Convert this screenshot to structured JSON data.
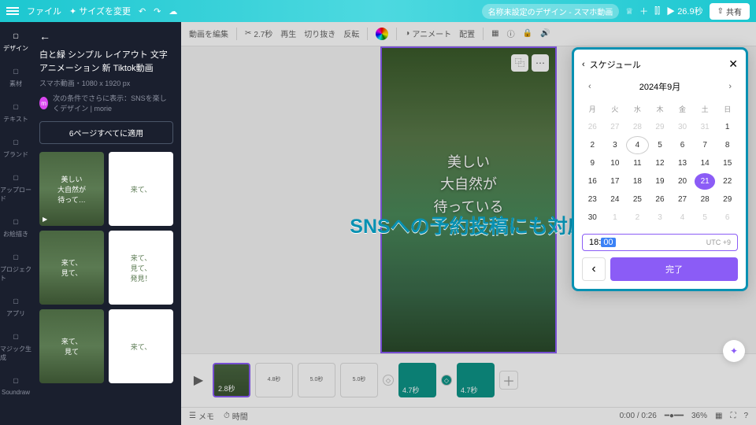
{
  "topbar": {
    "file_label": "ファイル",
    "resize_label": "サイズを変更",
    "doc_title": "名称未設定のデザイン - スマホ動画",
    "duration": "26.9秒",
    "share": "共有"
  },
  "rail": [
    {
      "label": "デザイン",
      "icon": "layout"
    },
    {
      "label": "素材",
      "icon": "shapes"
    },
    {
      "label": "テキスト",
      "icon": "text"
    },
    {
      "label": "ブランド",
      "icon": "brand"
    },
    {
      "label": "アップロード",
      "icon": "upload"
    },
    {
      "label": "お絵描き",
      "icon": "draw"
    },
    {
      "label": "プロジェクト",
      "icon": "folder"
    },
    {
      "label": "アプリ",
      "icon": "apps"
    },
    {
      "label": "マジック生成",
      "icon": "magic"
    },
    {
      "label": "Soundraw",
      "icon": "music"
    }
  ],
  "sidepanel": {
    "title": "白と緑  シンプル  レイアウト  文字アニメーション  新  Tiktok動画",
    "subtitle": "スマホ動画・1080 x 1920 px",
    "info": "次の条件でさらに表示：SNSを楽しくデザイン | morie",
    "apply": "6ページすべてに適用",
    "thumbs": [
      {
        "text": "美しい\n大自然が\n待って…"
      },
      {
        "text": "来て、"
      },
      {
        "text": "来て、\n見て、"
      },
      {
        "text": "来て、\n見て、\n発見！"
      },
      {
        "text": "来て、\n見て"
      },
      {
        "text": "来て、"
      }
    ]
  },
  "toolbar": {
    "edit": "動画を編集",
    "trim": "2.7秒",
    "play": "再生",
    "clip": "切り抜き",
    "flip": "反転",
    "animate": "アニメート",
    "position": "配置"
  },
  "canvas": {
    "line1": "美しい",
    "line2": "大自然が",
    "line3": "待っている"
  },
  "headline": "SNSへの予約投稿にも対応",
  "timeline": {
    "clips": [
      "2.8秒",
      "4.8秒",
      "5.0秒",
      "5.0秒",
      "4.7秒",
      "4.7秒"
    ]
  },
  "status": {
    "memo": "メモ",
    "duration_toggle": "時間",
    "time": "0:00 / 0:26",
    "zoom": "36%"
  },
  "scheduler": {
    "title": "スケジュール",
    "month": "2024年9月",
    "dows": [
      "月",
      "火",
      "水",
      "木",
      "金",
      "土",
      "日"
    ],
    "weeks": [
      [
        {
          "d": 26,
          "dim": true
        },
        {
          "d": 27,
          "dim": true
        },
        {
          "d": 28,
          "dim": true
        },
        {
          "d": 29,
          "dim": true
        },
        {
          "d": 30,
          "dim": true
        },
        {
          "d": 31,
          "dim": true
        },
        {
          "d": 1
        }
      ],
      [
        {
          "d": 2
        },
        {
          "d": 3
        },
        {
          "d": 4,
          "today": true
        },
        {
          "d": 5
        },
        {
          "d": 6
        },
        {
          "d": 7
        },
        {
          "d": 8
        }
      ],
      [
        {
          "d": 9
        },
        {
          "d": 10
        },
        {
          "d": 11
        },
        {
          "d": 12
        },
        {
          "d": 13
        },
        {
          "d": 14
        },
        {
          "d": 15
        }
      ],
      [
        {
          "d": 16
        },
        {
          "d": 17
        },
        {
          "d": 18
        },
        {
          "d": 19
        },
        {
          "d": 20
        },
        {
          "d": 21,
          "sel": true
        },
        {
          "d": 22
        }
      ],
      [
        {
          "d": 23
        },
        {
          "d": 24
        },
        {
          "d": 25
        },
        {
          "d": 26
        },
        {
          "d": 27
        },
        {
          "d": 28
        },
        {
          "d": 29
        }
      ],
      [
        {
          "d": 30
        },
        {
          "d": 1,
          "dim": true
        },
        {
          "d": 2,
          "dim": true
        },
        {
          "d": 3,
          "dim": true
        },
        {
          "d": 4,
          "dim": true
        },
        {
          "d": 5,
          "dim": true
        },
        {
          "d": 6,
          "dim": true
        }
      ]
    ],
    "time_hh": "18",
    "time_mm": "00",
    "tz": "UTC +9",
    "done": "完了"
  }
}
